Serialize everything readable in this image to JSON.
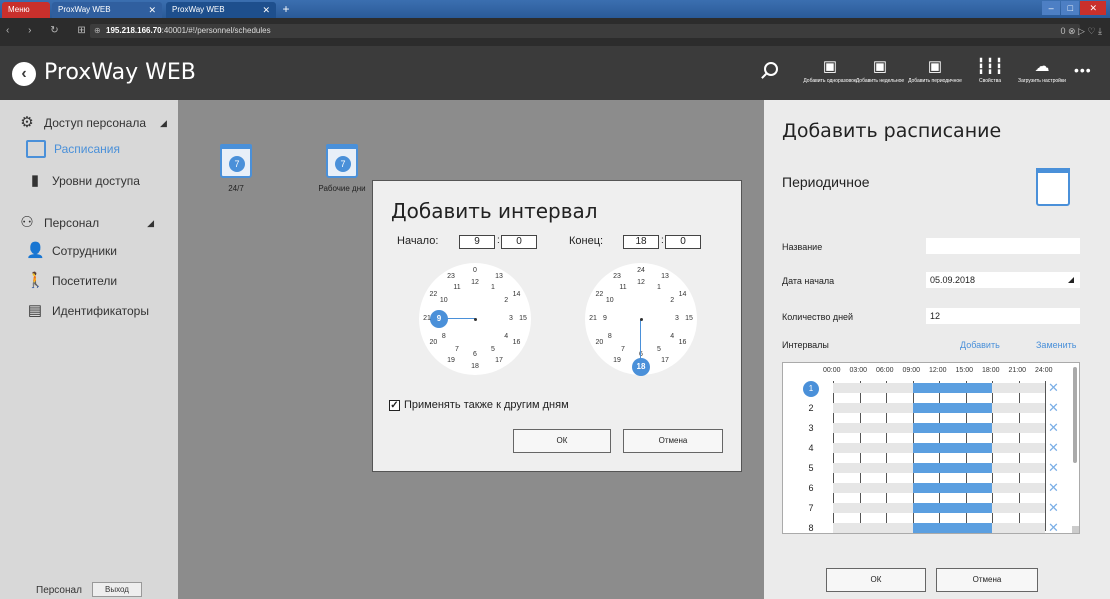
{
  "browser": {
    "menu_label": "Меню",
    "tabs": [
      {
        "label": "ProxWay WEB"
      },
      {
        "label": "ProxWay WEB"
      }
    ],
    "url_host": "195.218.166.70",
    "url_rest": ":40001/#!/personnel/schedules",
    "addr_right": "0 ⊗ ▷ ♡ ⤓"
  },
  "app": {
    "title": "ProxWay WEB"
  },
  "toolbar": {
    "items": [
      {
        "label": "Добавить одноразовое",
        "icon": "calendar-add-icon"
      },
      {
        "label": "Добавить недельное",
        "icon": "calendar-add-icon"
      },
      {
        "label": "Добавить периодичное",
        "icon": "calendar-add-icon"
      },
      {
        "label": "Свойства",
        "icon": "sliders-icon"
      },
      {
        "label": "Загрузить настройки",
        "icon": "cloud-upload-icon"
      }
    ]
  },
  "sidebar": {
    "sections": [
      {
        "label": "Доступ персонала",
        "icon": "gear-icon"
      },
      {
        "label": "Расписания",
        "icon": "calendar-icon"
      },
      {
        "label": "Уровни доступа",
        "icon": "door-icon"
      },
      {
        "label": "Персонал",
        "icon": "people-icon"
      },
      {
        "label": "Сотрудники",
        "icon": "user-icon"
      },
      {
        "label": "Посетители",
        "icon": "walker-icon"
      },
      {
        "label": "Идентификаторы",
        "icon": "card-reader-icon"
      }
    ],
    "footer_label": "Персонал",
    "logout_label": "Выход"
  },
  "schedules": [
    {
      "label": "24/7",
      "badge": "7"
    },
    {
      "label": "Рабочие дни",
      "badge": "7"
    }
  ],
  "dialog": {
    "title": "Добавить интервал",
    "start_label": "Начало:",
    "start_hour": "9",
    "start_min": "0",
    "end_label": "Конец:",
    "end_hour": "18",
    "end_min": "0",
    "apply_label": "Применять также к другим дням",
    "apply_checked": true,
    "ok_label": "ОК",
    "cancel_label": "Отмена",
    "clock1": {
      "selected": "9",
      "numbers": [
        "12",
        "1",
        "2",
        "3",
        "4",
        "5",
        "6",
        "7",
        "8",
        "9",
        "10",
        "11",
        "0",
        "13",
        "14",
        "15",
        "16",
        "17",
        "18",
        "19",
        "20",
        "21",
        "22",
        "23"
      ]
    },
    "clock2": {
      "selected": "18",
      "numbers": [
        "12",
        "1",
        "2",
        "3",
        "4",
        "5",
        "6",
        "7",
        "8",
        "9",
        "10",
        "11",
        "24",
        "13",
        "14",
        "15",
        "16",
        "17",
        "18",
        "19",
        "20",
        "21",
        "22",
        "23"
      ]
    }
  },
  "panel": {
    "title": "Добавить расписание",
    "subtitle": "Периодичное",
    "name_label": "Название",
    "name_value": "",
    "start_date_label": "Дата начала",
    "start_date_value": "05.09.2018",
    "days_label": "Количество дней",
    "days_value": "12",
    "intervals_label": "Интервалы",
    "add_label": "Добавить",
    "replace_label": "Заменить",
    "hours": [
      "00:00",
      "03:00",
      "06:00",
      "09:00",
      "12:00",
      "15:00",
      "18:00",
      "21:00",
      "24:00"
    ],
    "rows": [
      {
        "label": "1",
        "start": 9,
        "end": 18
      },
      {
        "label": "2",
        "start": 9,
        "end": 18
      },
      {
        "label": "3",
        "start": 9,
        "end": 18
      },
      {
        "label": "4",
        "start": 9,
        "end": 18
      },
      {
        "label": "5",
        "start": 9,
        "end": 18
      },
      {
        "label": "6",
        "start": 9,
        "end": 18
      },
      {
        "label": "7",
        "start": 9,
        "end": 18
      },
      {
        "label": "8",
        "start": 9,
        "end": 18
      }
    ],
    "ok_label": "ОК",
    "cancel_label": "Отмена"
  }
}
